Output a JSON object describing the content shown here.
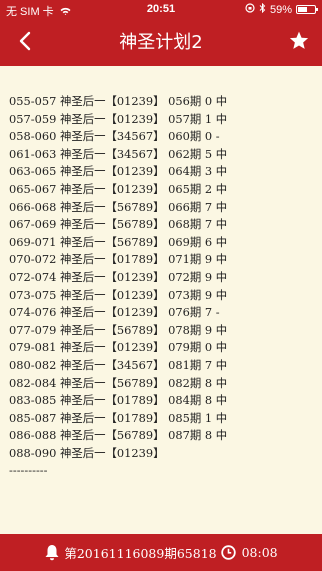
{
  "status_bar": {
    "carrier": "无 SIM 卡",
    "time": "20:51",
    "battery_text": "59%",
    "battery_level": 0.59
  },
  "navbar": {
    "title": "神圣计划2"
  },
  "plan": {
    "rows": [
      "055-057 神圣后一【01239】 056期 0 中",
      "057-059 神圣后一【01239】 057期 1 中",
      "058-060 神圣后一【34567】 060期 0 -",
      "061-063 神圣后一【34567】 062期 5 中",
      "063-065 神圣后一【01239】 064期 3 中",
      "065-067 神圣后一【01239】 065期 2 中",
      "066-068 神圣后一【56789】 066期 7 中",
      "067-069 神圣后一【56789】 068期 7 中",
      "069-071 神圣后一【56789】 069期 6 中",
      "070-072 神圣后一【01789】 071期 9 中",
      "072-074 神圣后一【01239】 072期 9 中",
      "073-075 神圣后一【01239】 073期 9 中",
      "074-076 神圣后一【01239】 076期 7 -",
      "077-079 神圣后一【56789】 078期 9 中",
      "079-081 神圣后一【01239】 079期 0 中",
      "080-082 神圣后一【34567】 081期 7 中",
      "082-084 神圣后一【56789】 082期 8 中",
      "083-085 神圣后一【01789】 084期 8 中",
      "085-087 神圣后一【01789】 085期 1 中",
      "086-088 神圣后一【56789】 087期 8 中",
      "088-090 神圣后一【01239】",
      "----------"
    ]
  },
  "footer": {
    "issue_text": "第20161116089期65818",
    "time": "08:08"
  }
}
